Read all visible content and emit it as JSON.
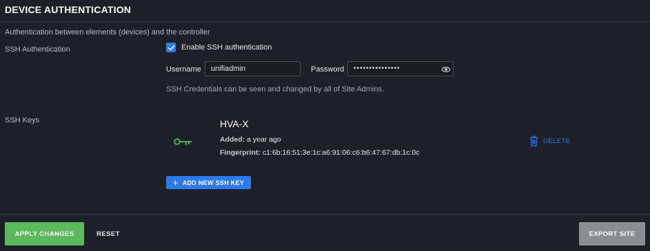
{
  "section": {
    "title": "DEVICE AUTHENTICATION",
    "subtitle": "Authentication between elements (devices) and the controller"
  },
  "ssh_auth": {
    "label": "SSH Authentication",
    "enable_checkbox": {
      "label": "Enable SSH authentication",
      "checked": true
    },
    "username": {
      "label": "Username",
      "value": "unifiadmin"
    },
    "password": {
      "label": "Password",
      "value": "•••••••••••••••"
    },
    "note": "SSH Credentials can be seen and changed by all of Site Admins."
  },
  "ssh_keys": {
    "label": "SSH Keys",
    "keys": [
      {
        "name": "HVA-X",
        "added_label": "Added:",
        "added_value": "a year ago",
        "fingerprint_label": "Fingerprint:",
        "fingerprint_value": "c1:6b:16:51:3e:1c:a6:91:06:c6:b6:47:67:db:1c:0c",
        "delete_label": "DELETE"
      }
    ],
    "add_button": "ADD NEW SSH KEY"
  },
  "footer": {
    "apply": "APPLY CHANGES",
    "reset": "RESET",
    "export": "EXPORT SITE"
  },
  "colors": {
    "background": "#1e2029",
    "accent_blue": "#2b7bef",
    "apply_green": "#5cb85c",
    "key_icon_green": "#4caf50",
    "export_gray": "#8b8d93"
  },
  "icons": {
    "checkbox": "checkmark-icon",
    "eye": "eye-icon",
    "key": "key-icon",
    "delete": "trash-icon",
    "add": "plus-icon"
  }
}
